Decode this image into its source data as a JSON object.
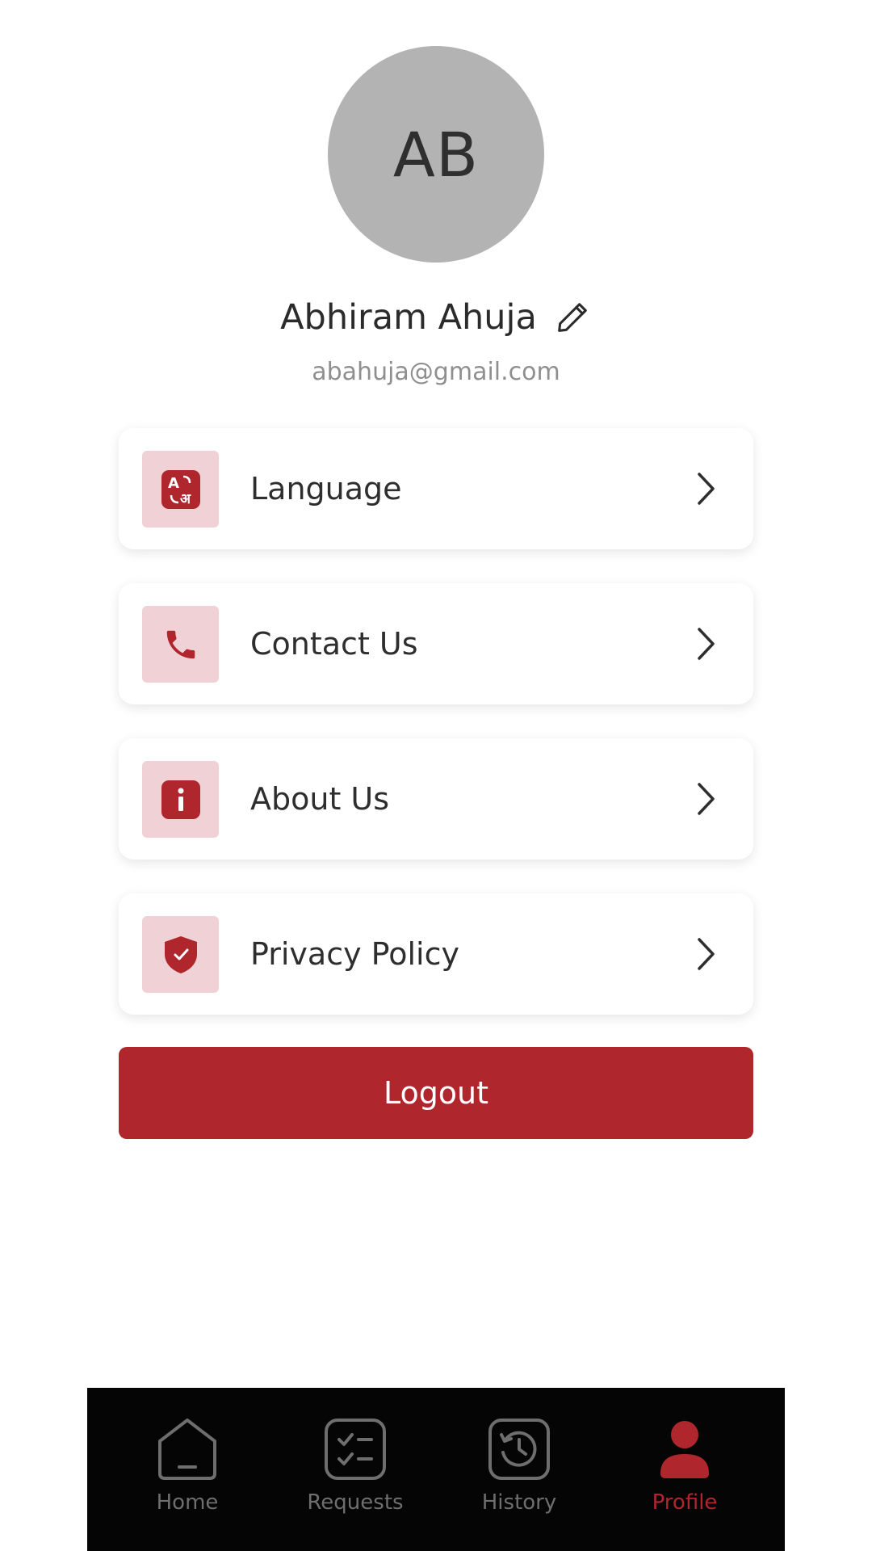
{
  "profile": {
    "initials": "AB",
    "name": "Abhiram Ahuja",
    "email": "abahuja@gmail.com"
  },
  "menu": {
    "items": [
      {
        "label": "Language",
        "icon": "language-icon"
      },
      {
        "label": "Contact Us",
        "icon": "phone-icon"
      },
      {
        "label": "About Us",
        "icon": "info-icon"
      },
      {
        "label": "Privacy Policy",
        "icon": "shield-check-icon"
      }
    ]
  },
  "logout_label": "Logout",
  "nav": {
    "items": [
      {
        "label": "Home",
        "icon": "home-icon",
        "active": false
      },
      {
        "label": "Requests",
        "icon": "checklist-icon",
        "active": false
      },
      {
        "label": "History",
        "icon": "history-icon",
        "active": false
      },
      {
        "label": "Profile",
        "icon": "user-icon",
        "active": true
      }
    ]
  },
  "colors": {
    "accent": "#b0262d",
    "icon_bg": "#f0d2d6",
    "avatar_bg": "#b3b3b3",
    "nav_bg": "#050505",
    "nav_inactive": "#6e6e6e"
  }
}
